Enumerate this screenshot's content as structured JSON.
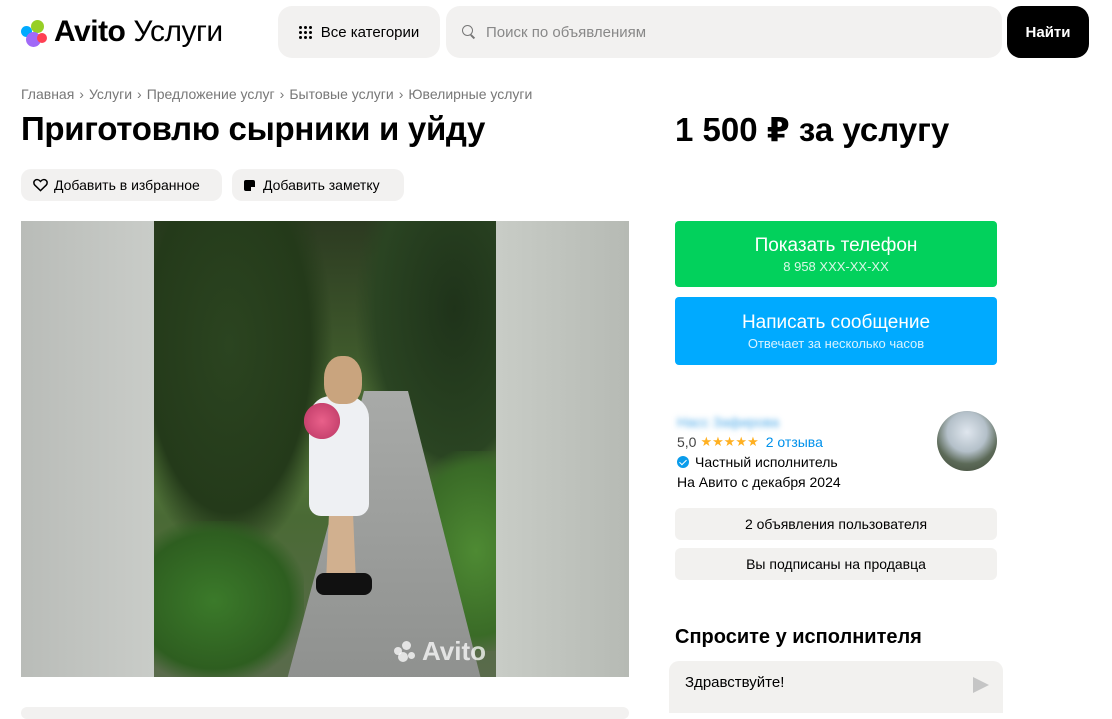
{
  "header": {
    "logo_brand": "Avito",
    "logo_service": "Услуги",
    "categories_label": "Все категории",
    "search_placeholder": "Поиск по объявлениям",
    "find_label": "Найти"
  },
  "breadcrumb": [
    "Главная",
    "Услуги",
    "Предложение услуг",
    "Бытовые услуги",
    "Ювелирные услуги"
  ],
  "listing": {
    "title": "Приготовлю сырники и уйду",
    "price": "1 500 ₽ за услугу",
    "favorite_label": "Добавить в избранное",
    "note_label": "Добавить заметку",
    "watermark": "Avito"
  },
  "contact": {
    "phone_label": "Показать телефон",
    "phone_number": "8 958 XXX-XX-XX",
    "message_label": "Написать сообщение",
    "message_sub": "Отвечает за несколько часов"
  },
  "seller": {
    "name": "Насс Зафирова",
    "rating": "5,0",
    "stars": "★★★★★",
    "reviews": "2 отзыва",
    "type": "Частный исполнитель",
    "since": "На Авито с декабря 2024",
    "listings_button": "2 объявления пользователя",
    "subscribed_button": "Вы подписаны на продавца"
  },
  "ask": {
    "title": "Спросите у исполнителя",
    "message": "Здравствуйте!"
  },
  "colors": {
    "phone_button": "#02d15c",
    "message_button": "#00aaff",
    "link": "#0091eb",
    "stars": "#ffb021"
  }
}
